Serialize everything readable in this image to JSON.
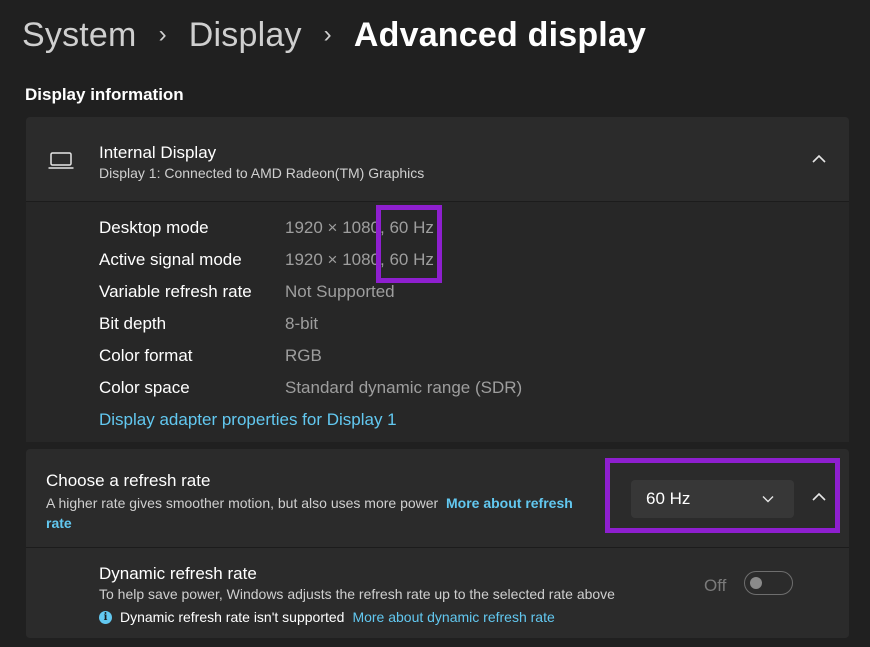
{
  "breadcrumb": {
    "items": [
      "System",
      "Display"
    ],
    "current": "Advanced display"
  },
  "section_title": "Display information",
  "display_card": {
    "icon": "laptop-icon",
    "title": "Internal Display",
    "subtitle": "Display 1: Connected to AMD Radeon(TM) Graphics",
    "rows": [
      {
        "label": "Desktop mode",
        "value": "1920 × 1080, 60 Hz"
      },
      {
        "label": "Active signal mode",
        "value": "1920 × 1080, 60 Hz"
      },
      {
        "label": "Variable refresh rate",
        "value": "Not Supported"
      },
      {
        "label": "Bit depth",
        "value": "8-bit"
      },
      {
        "label": "Color format",
        "value": "RGB"
      },
      {
        "label": "Color space",
        "value": "Standard dynamic range (SDR)"
      }
    ],
    "adapter_link": "Display adapter properties for Display 1"
  },
  "refresh_card": {
    "title": "Choose a refresh rate",
    "description": "A higher rate gives smoother motion, but also uses more power",
    "link": "More about refresh rate",
    "selected_rate": "60 Hz",
    "dynamic": {
      "title": "Dynamic refresh rate",
      "description": "To help save power, Windows adjusts the refresh rate up to the selected rate above",
      "note": "Dynamic refresh rate isn't supported",
      "link": "More about dynamic refresh rate",
      "toggle_label": "Off",
      "toggle_on": false
    }
  },
  "colors": {
    "accent_link": "#62c8f0",
    "highlight": "#8e1fcf",
    "background": "#202020",
    "card": "#2b2b2b"
  }
}
